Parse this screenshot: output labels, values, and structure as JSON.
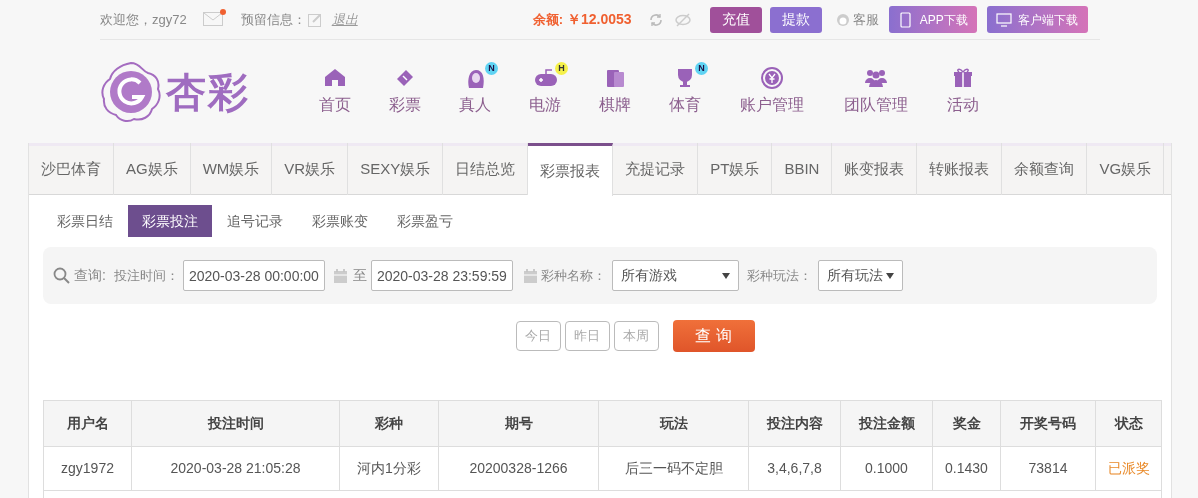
{
  "top_bar": {
    "welcome": "欢迎您，zgy72",
    "reserved_label": "预留信息：",
    "logout": "退出",
    "balance_label": "余额:",
    "balance": "￥12.0053",
    "buttons": [
      {
        "label": "充值",
        "kind": "deposit"
      },
      {
        "label": "提款",
        "kind": "withdraw"
      }
    ],
    "service": "客服",
    "downloads": [
      {
        "label": "APP下载",
        "kind": "phone"
      },
      {
        "label": "客户端下载",
        "kind": "desktop"
      }
    ]
  },
  "logo": {
    "text": "杏彩"
  },
  "nav": [
    {
      "label": "首页"
    },
    {
      "label": "彩票"
    },
    {
      "label": "真人",
      "badge": "N"
    },
    {
      "label": "电游",
      "badge": "H"
    },
    {
      "label": "棋牌"
    },
    {
      "label": "体育",
      "badge": "N"
    },
    {
      "label": "账户管理"
    },
    {
      "label": "团队管理"
    },
    {
      "label": "活动"
    }
  ],
  "tabs": [
    {
      "label": "沙巴体育",
      "selected": false
    },
    {
      "label": "AG娱乐",
      "selected": false
    },
    {
      "label": "WM娱乐",
      "selected": false
    },
    {
      "label": "VR娱乐",
      "selected": false
    },
    {
      "label": "SEXY娱乐",
      "selected": false
    },
    {
      "label": "日结总览",
      "selected": false
    },
    {
      "label": "彩票报表",
      "selected": true
    },
    {
      "label": "充提记录",
      "selected": false
    },
    {
      "label": "PT娱乐",
      "selected": false
    },
    {
      "label": "BBIN",
      "selected": false
    },
    {
      "label": "账变报表",
      "selected": false
    },
    {
      "label": "转账报表",
      "selected": false
    },
    {
      "label": "余额查询",
      "selected": false
    },
    {
      "label": "VG娱乐",
      "selected": false
    }
  ],
  "sub_tabs": [
    {
      "label": "彩票日结",
      "selected": false
    },
    {
      "label": "彩票投注",
      "selected": true
    },
    {
      "label": "追号记录",
      "selected": false
    },
    {
      "label": "彩票账变",
      "selected": false
    },
    {
      "label": "彩票盈亏",
      "selected": false
    }
  ],
  "filter": {
    "query_label": "查询:",
    "time_label": "投注时间：",
    "start": "2020-03-28 00:00:00",
    "to": "至",
    "end": "2020-03-28 23:59:59",
    "game_label": "彩种名称：",
    "game": "所有游戏",
    "play_label": "彩种玩法：",
    "play": "所有玩法"
  },
  "quick_buttons": [
    "今日",
    "昨日",
    "本周"
  ],
  "search_button": "查 询",
  "table": {
    "columns": [
      "用户名",
      "投注时间",
      "彩种",
      "期号",
      "玩法",
      "投注内容",
      "投注金额",
      "奖金",
      "开奖号码",
      "状态"
    ],
    "rows": [
      {
        "cells": [
          "zgy1972",
          "2020-03-28 21:05:28",
          "河内1分彩",
          "20200328-1266",
          "后三一码不定胆",
          "3,4,6,7,8",
          "0.1000",
          "0.1430",
          "73814",
          "已派奖"
        ]
      }
    ]
  }
}
